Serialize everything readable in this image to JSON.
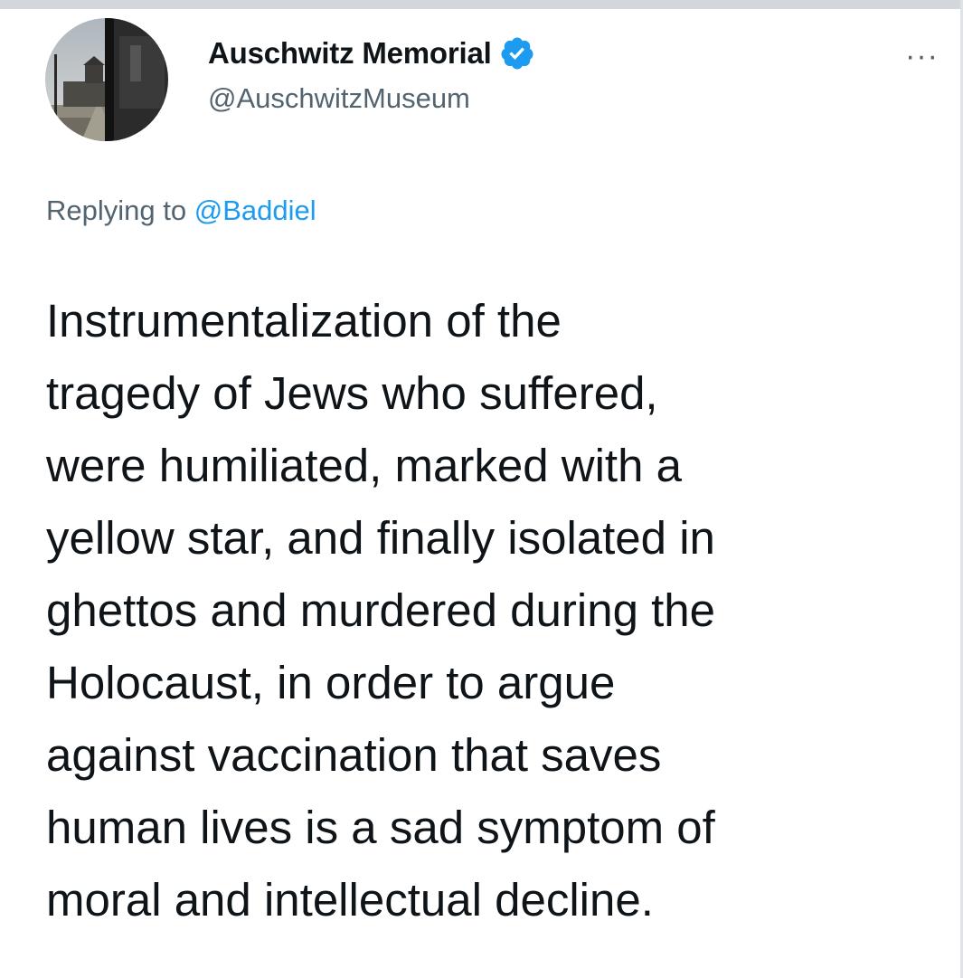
{
  "author": {
    "display_name": "Auschwitz Memorial",
    "handle": "@AuschwitzMuseum",
    "verified": true,
    "verified_icon": "verified-badge-icon",
    "avatar_icon": "camp-gate-photo-avatar"
  },
  "menu": {
    "more_icon": "more-options-icon",
    "more_label": "···"
  },
  "reply_context": {
    "prefix": "Replying to",
    "mention": "@Baddiel"
  },
  "tweet": {
    "text": "Instrumentalization of the\ntragedy of Jews who suffered,\nwere humiliated, marked with a\nyellow star, and finally isolated in\nghettos and murdered during the\nHolocaust, in order to argue\nagainst vaccination that saves\nhuman lives is a sad symptom of\nmoral and intellectual decline."
  },
  "colors": {
    "accent": "#1d9bf0",
    "text_primary": "#0f1419",
    "text_secondary": "#536471"
  }
}
